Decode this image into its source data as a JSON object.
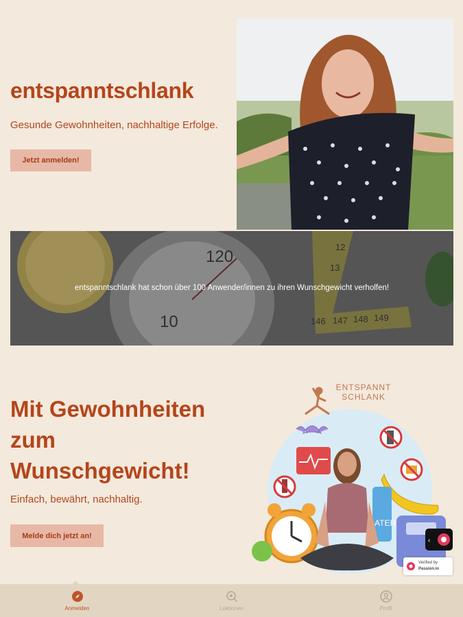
{
  "hero": {
    "title": "entspanntschlank",
    "subtitle": "Gesunde Gewohnheiten, nachhaltige Erfolge.",
    "cta_label": "Jetzt anmelden!"
  },
  "banner": {
    "text": "entspanntschlank hat schon über 100 Anwender/innen zu ihren Wunschgewicht verholfen!",
    "scale_numbers": [
      "120",
      "10"
    ],
    "tape_numbers": [
      "146",
      "147",
      "148",
      "149",
      "13",
      "12"
    ]
  },
  "section2": {
    "title_lines": [
      "Mit Gewohnheiten",
      "zum",
      "Wunschgewicht!"
    ],
    "subtitle": "Einfach, bewährt, nachhaltig.",
    "cta_label": "Melde dich jetzt an!"
  },
  "illustration": {
    "brand_line1": "ENTSPANNT",
    "brand_line2": "SCHLANK",
    "verified_line1": "Verified by",
    "verified_line2": "Passion.io",
    "bottle_text": "ATER"
  },
  "bottom_nav": {
    "items": [
      {
        "label": "Anmelden",
        "icon": "compass-icon",
        "active": true
      },
      {
        "label": "Lektionen",
        "icon": "search-lesson-icon",
        "active": false
      },
      {
        "label": "Profil",
        "icon": "user-icon",
        "active": false
      }
    ]
  },
  "colors": {
    "background": "#f3e9dc",
    "accent": "#b5451b",
    "button_bg": "#e8b8a6",
    "nav_bg": "#e2d6c3"
  }
}
